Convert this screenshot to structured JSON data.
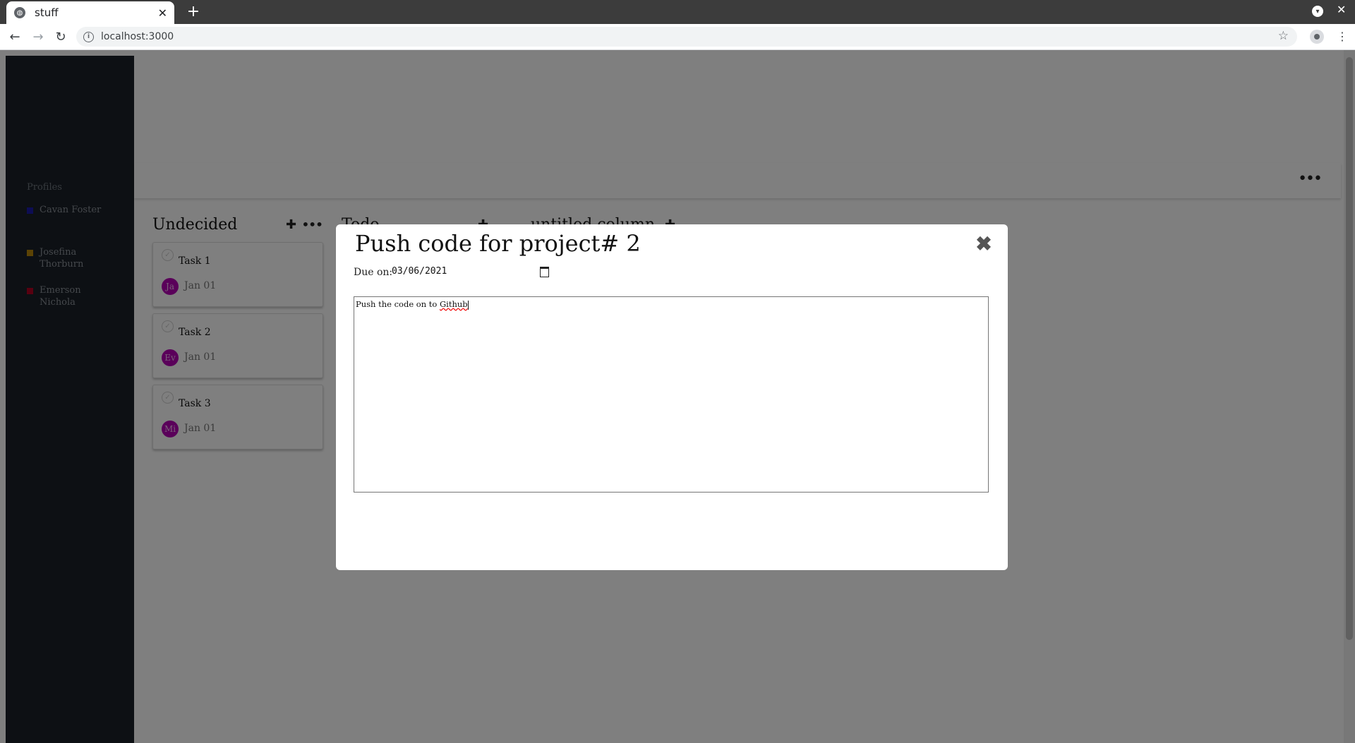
{
  "browser": {
    "tab_title": "stuff",
    "new_tab_symbol": "+",
    "url": "localhost:3000",
    "icons": [
      "globe-icon",
      "close-icon",
      "back-icon",
      "forward-icon",
      "reload-icon",
      "info-icon",
      "star-icon",
      "profile-icon",
      "kebab-menu-icon"
    ]
  },
  "sidebar": {
    "heading": "Profiles",
    "profiles": [
      {
        "name_line1": "Cavan Foster",
        "name_line2": "",
        "color": "#1a1aa8"
      },
      {
        "name_line1": "Josefina",
        "name_line2": "Thorburn",
        "color": "#b8860b"
      },
      {
        "name_line1": "Emerson",
        "name_line2": "Nichola",
        "color": "#b00020"
      }
    ]
  },
  "board": {
    "menu_symbol": "•••",
    "columns": [
      {
        "title": "Undecided",
        "add_symbol": "✚",
        "menu_symbol": "•••"
      },
      {
        "title": "Todo",
        "add_symbol": "✚"
      },
      {
        "title": "untitled column",
        "add_symbol": "✚"
      }
    ],
    "cards": [
      {
        "title": "Task 1",
        "avatar": "Ja",
        "date": "Jan 01"
      },
      {
        "title": "Task 2",
        "avatar": "Ev",
        "date": "Jan 01"
      },
      {
        "title": "Task 3",
        "avatar": "Mi",
        "date": "Jan 01"
      }
    ]
  },
  "modal": {
    "title": "Push code for project# 2",
    "close_symbol": "✖",
    "due_label": "Due on:",
    "due_value": "03/06/2021",
    "description_prefix": "Push the code on to ",
    "description_misspelled": "Github"
  },
  "colors": {
    "sidebar_bg": "#1b2128",
    "avatar_bg": "#b400b4",
    "overlay": "rgba(0,0,0,0.5)"
  }
}
